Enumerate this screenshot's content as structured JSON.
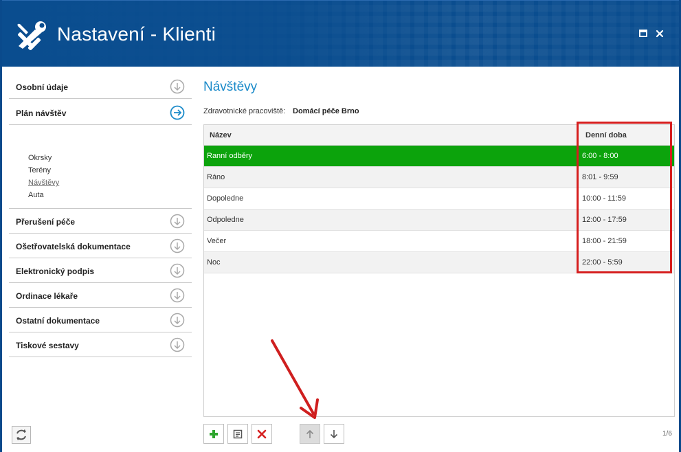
{
  "window": {
    "title": "Nastavení - Klienti",
    "icon": "tools-icon",
    "controls": [
      "maximize-icon",
      "close-icon"
    ]
  },
  "sidebar": {
    "items": [
      {
        "label": "Osobní údaje",
        "icon": "arrow-down-circle-icon"
      },
      {
        "label": "Plán návštěv",
        "icon": "arrow-right-circle-icon",
        "expanded": true,
        "children": [
          "Okrsky",
          "Terény",
          "Návštěvy",
          "Auta"
        ],
        "active_child": "Návštěvy"
      },
      {
        "label": "Přerušení péče",
        "icon": "arrow-down-circle-icon"
      },
      {
        "label": "Ošetřovatelská dokumentace",
        "icon": "arrow-down-circle-icon"
      },
      {
        "label": "Elektronický podpis",
        "icon": "arrow-down-circle-icon"
      },
      {
        "label": "Ordinace lékaře",
        "icon": "arrow-down-circle-icon"
      },
      {
        "label": "Ostatní dokumentace",
        "icon": "arrow-down-circle-icon"
      },
      {
        "label": "Tiskové sestavy",
        "icon": "arrow-down-circle-icon"
      }
    ]
  },
  "main": {
    "title": "Návštěvy",
    "workplace_label": "Zdravotnické pracoviště:",
    "workplace_value": "Domácí péče Brno",
    "table": {
      "columns": [
        "Název",
        "Denní doba"
      ],
      "rows": [
        {
          "name": "Ranní odběry",
          "time": "6:00 - 8:00",
          "selected": true
        },
        {
          "name": "Ráno",
          "time": "8:01 - 9:59"
        },
        {
          "name": "Dopoledne",
          "time": "10:00 - 11:59"
        },
        {
          "name": "Odpoledne",
          "time": "12:00 - 17:59"
        },
        {
          "name": "Večer",
          "time": "18:00 - 21:59"
        },
        {
          "name": "Noc",
          "time": "22:00 - 5:59"
        }
      ]
    },
    "toolbar": {
      "buttons": [
        "add-icon",
        "edit-icon",
        "delete-icon",
        "move-up-icon",
        "move-down-icon"
      ],
      "disabled": [
        "move-up-icon"
      ]
    },
    "pager": "1/6"
  },
  "colors": {
    "titlebar": "#0a4d8f",
    "accent_title": "#1a8ac9",
    "selection": "#0ca30c",
    "annotation": "#d61e1e"
  }
}
